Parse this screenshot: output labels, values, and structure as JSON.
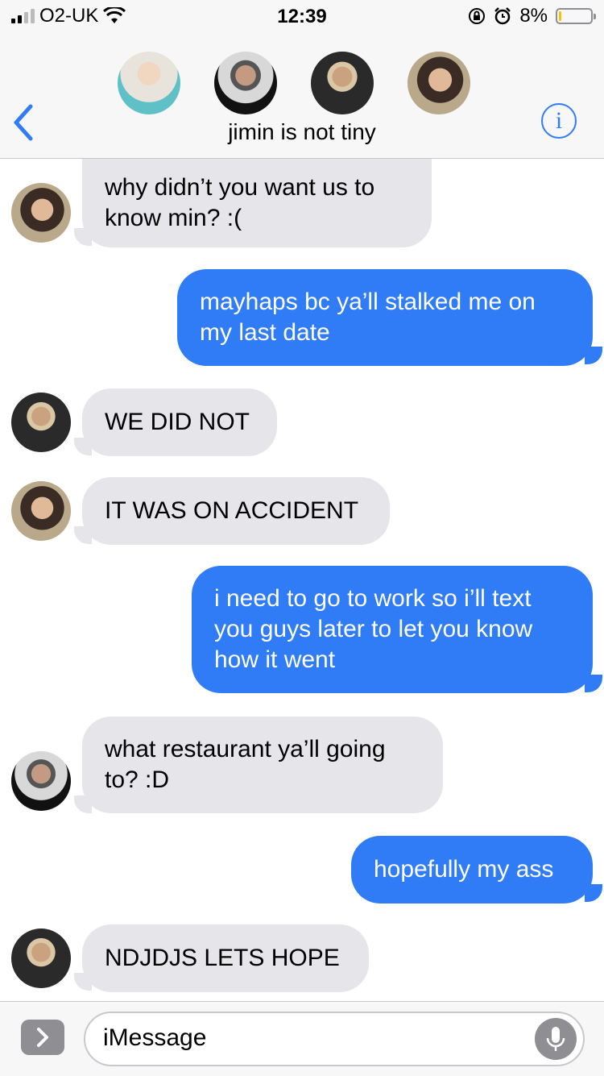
{
  "status_bar": {
    "carrier": "O2-UK",
    "time": "12:39",
    "battery_percent": "8%",
    "battery_level": 0.08,
    "battery_color": "#f5c400"
  },
  "header": {
    "group_name": "jimin is not tiny",
    "back_icon": "chevron-left-icon",
    "info_icon": "info-icon",
    "accent_color": "#2f7cf6"
  },
  "messages": [
    {
      "direction": "in",
      "text": "why didn’t you want us to know min? :("
    },
    {
      "direction": "out",
      "text": "mayhaps bc ya’ll stalked me on my last date"
    },
    {
      "direction": "in",
      "text": "WE DID NOT"
    },
    {
      "direction": "in",
      "text": "IT WAS ON ACCIDENT"
    },
    {
      "direction": "out",
      "text": "i need to go to work so i’ll text you guys later to let you know how it went"
    },
    {
      "direction": "in",
      "text": "what restaurant ya’ll going to? :D"
    },
    {
      "direction": "out",
      "text": "hopefully my ass"
    },
    {
      "direction": "in",
      "text": "NDJDJS LETS HOPE"
    }
  ],
  "composer": {
    "placeholder": "iMessage",
    "apps_icon": "chevron-right-icon",
    "mic_icon": "microphone-icon"
  }
}
